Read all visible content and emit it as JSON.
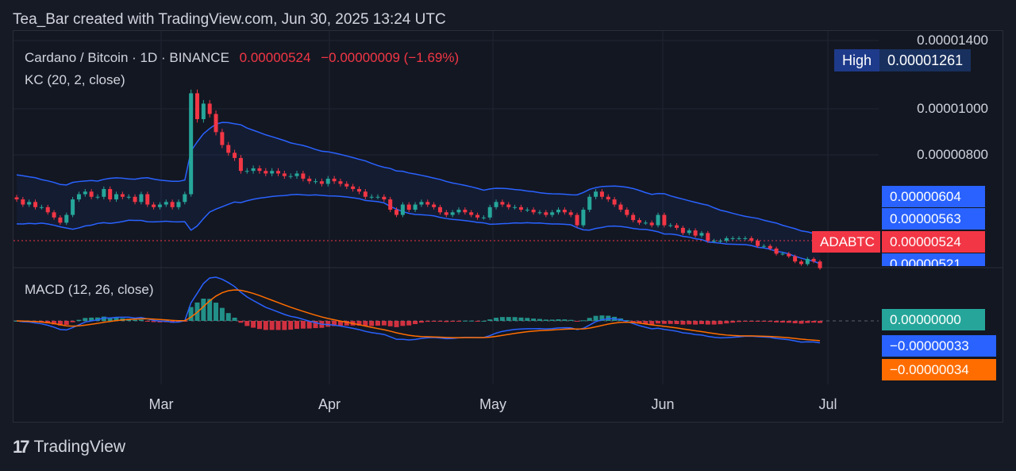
{
  "header": {
    "credit": "Tea_Bar created with TradingView.com, Jun 30, 2025 13:24 UTC"
  },
  "legend": {
    "symbol": "Cardano / Bitcoin · 1D · BINANCE",
    "price": "0.00000524",
    "change": "−0.00000009 (−1.69%)",
    "kc": "KC (20, 2, close)",
    "macd": "MACD (12, 26, close)"
  },
  "high_label": {
    "key": "High",
    "value": "0.00001261"
  },
  "price_tags": {
    "kc_upper": "0.00000604",
    "kc_mid": "0.00000563",
    "last_symbol": "ADABTC",
    "last": "0.00000524",
    "kc_lower": "0.00000521"
  },
  "macd_tags": {
    "hist": "0.00000000",
    "macd": "−0.00000033",
    "signal": "−0.00000034"
  },
  "footer": {
    "brand": "TradingView",
    "logo": "17"
  },
  "colors": {
    "up": "#26a69a",
    "down": "#f23645",
    "band": "#2962ff",
    "macd": "#2962ff",
    "signal": "#ff6d00",
    "hist_up": "#26a69a",
    "hist_down": "#f23645"
  },
  "chart_data": {
    "type": "candlestick",
    "y_axis_ticks": [
      "0.00001400",
      "0.00001000",
      "0.00000800"
    ],
    "x_axis_ticks": [
      "Mar",
      "Apr",
      "May",
      "Jun",
      "Jul"
    ],
    "ylim": [
      5.2e-06,
      1.41e-05
    ],
    "close": [
      7.9e-06,
      7.7e-06,
      7.8e-06,
      7.6e-06,
      7.6e-06,
      7.4e-06,
      7.2e-06,
      7e-06,
      7.3e-06,
      7.9e-06,
      8.1e-06,
      8.2e-06,
      8e-06,
      8e-06,
      8.3e-06,
      7.9e-06,
      8.1e-06,
      8e-06,
      8e-06,
      7.8e-06,
      8.1e-06,
      7.7e-06,
      7.6e-06,
      7.7e-06,
      7.8e-06,
      7.6e-06,
      7.8e-06,
      8.1e-06,
      1.2e-05,
      1.1e-05,
      1.16e-05,
      1.12e-05,
      1.05e-05,
      1e-05,
      9.7e-06,
      9.5e-06,
      9e-06,
      9e-06,
      9.1e-06,
      9e-06,
      8.9e-06,
      9e-06,
      8.9e-06,
      8.8e-06,
      8.8e-06,
      8.9e-06,
      8.7e-06,
      8.6e-06,
      8.6e-06,
      8.5e-06,
      8.7e-06,
      8.6e-06,
      8.5e-06,
      8.4e-06,
      8.3e-06,
      8.2e-06,
      8e-06,
      8e-06,
      8e-06,
      7.9e-06,
      7.5e-06,
      7.3e-06,
      7.7e-06,
      7.5e-06,
      7.7e-06,
      7.8e-06,
      7.7e-06,
      7.6e-06,
      7.4e-06,
      7.3e-06,
      7.4e-06,
      7.5e-06,
      7.4e-06,
      7.3e-06,
      7.2e-06,
      7.2e-06,
      7.6e-06,
      7.8e-06,
      7.7e-06,
      7.6e-06,
      7.6e-06,
      7.5e-06,
      7.5e-06,
      7.4e-06,
      7.4e-06,
      7.3e-06,
      7.4e-06,
      7.5e-06,
      7.4e-06,
      7.3e-06,
      6.9e-06,
      7.5e-06,
      8e-06,
      8.2e-06,
      8e-06,
      7.9e-06,
      7.7e-06,
      7.5e-06,
      7.3e-06,
      7.1e-06,
      7e-06,
      7e-06,
      6.9e-06,
      7.3e-06,
      6.9e-06,
      6.9e-06,
      6.8e-06,
      6.6e-06,
      6.7e-06,
      6.5e-06,
      6.6e-06,
      6.3e-06,
      6.3e-06,
      6.3e-06,
      6.4e-06,
      6.4e-06,
      6.4e-06,
      6.4e-06,
      6.3e-06,
      6.1e-06,
      6.1e-06,
      6e-06,
      5.8e-06,
      5.8e-06,
      5.7e-06,
      5.5e-06,
      5.4e-06,
      5.6e-06,
      5.5e-06,
      5.24e-06
    ]
  }
}
